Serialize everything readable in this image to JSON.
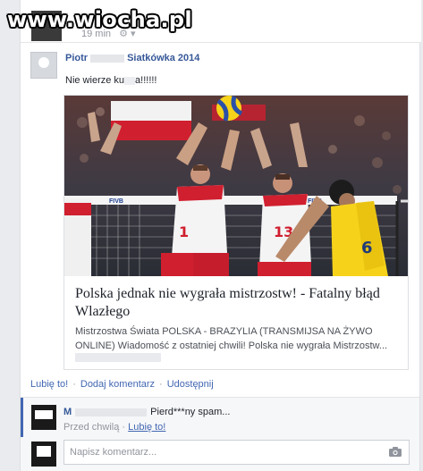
{
  "watermark": "www.wiocha.pl",
  "top_post": {
    "time": "19 min",
    "gear": "⚙ ▾"
  },
  "post": {
    "author_first": "Piotr",
    "group": "Siatkówka 2014",
    "text_start": "Nie wierze ku",
    "text_end": "a!!!!!!"
  },
  "link": {
    "title": "Polska jednak nie wygrała mistrzostw! - Fatalny błąd Wlazłego",
    "description": "Mistrzostwa Świata POLSKA - BRAZYLIA (TRANSMIJSA NA ŻYWO ONLINE) Wiadomość z ostatniej chwili! Polska nie wygrała Mistrzostw...",
    "photo_jerseys": [
      "1",
      "13",
      "6"
    ],
    "net_brand": "FIVB"
  },
  "actions": {
    "like": "Lubię to!",
    "comment": "Dodaj komentarz",
    "share": "Udostępnij"
  },
  "comment": {
    "author_initial": "M",
    "text": "Pierd***ny spam...",
    "time": "Przed chwilą",
    "like": "Lubię to!"
  },
  "write": {
    "placeholder": "Napisz komentarz..."
  },
  "colors": {
    "link_blue": "#365899",
    "action_blue": "#4267b2",
    "poland_red": "#d01f2f",
    "brazil_yellow": "#f6d31a"
  }
}
